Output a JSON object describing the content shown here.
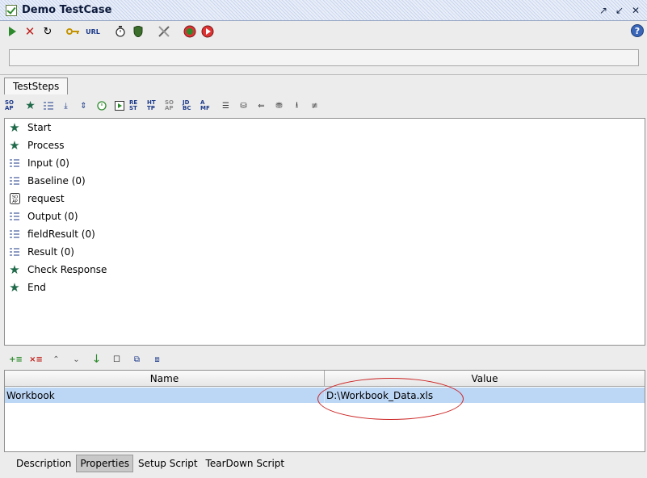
{
  "window": {
    "title": "Demo TestCase"
  },
  "toolbar": {
    "url_label": "URL"
  },
  "tabs": {
    "active": "TestSteps"
  },
  "steps_toolbar": {
    "labels": [
      "SO AP",
      "RE ST",
      "HT TP",
      "SO AP",
      "JD BC",
      "A MF"
    ]
  },
  "steps": [
    {
      "label": "Start",
      "icon": "star-icon"
    },
    {
      "label": "Process",
      "icon": "star-icon"
    },
    {
      "label": "Input (0)",
      "icon": "list-icon"
    },
    {
      "label": "Baseline (0)",
      "icon": "list-icon"
    },
    {
      "label": "request",
      "icon": "soap-icon"
    },
    {
      "label": "Output (0)",
      "icon": "list-icon"
    },
    {
      "label": "fieldResult (0)",
      "icon": "list-icon"
    },
    {
      "label": "Result (0)",
      "icon": "list-icon"
    },
    {
      "label": "Check Response",
      "icon": "star-icon"
    },
    {
      "label": "End",
      "icon": "star-icon"
    }
  ],
  "properties": {
    "columns": [
      "Name",
      "Value"
    ],
    "rows": [
      {
        "name": "Workbook",
        "value": "D:\\Workbook_Data.xls"
      }
    ]
  },
  "bottom_tabs": [
    "Description",
    "Properties",
    "Setup Script",
    "TearDown Script"
  ],
  "bottom_tab_active": "Properties",
  "colors": {
    "selection": "#bcd6f5",
    "annotation": "#cc2222"
  }
}
